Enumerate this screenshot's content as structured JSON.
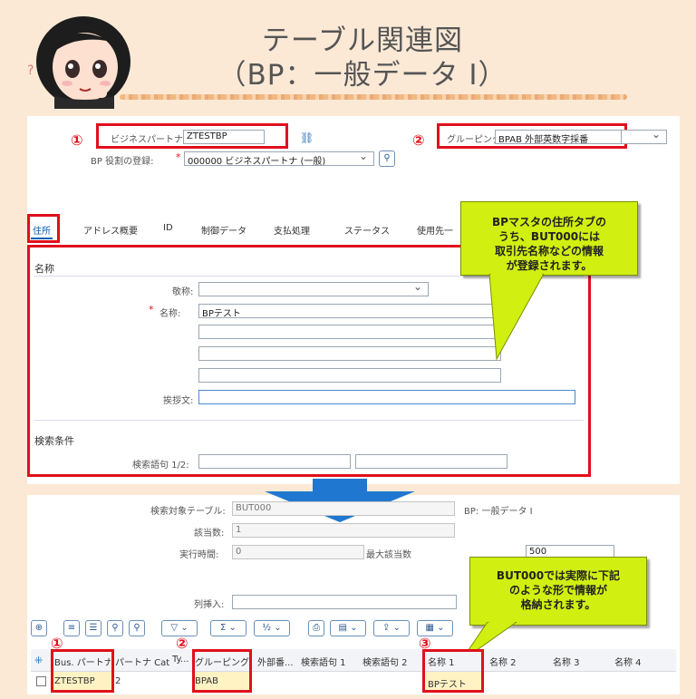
{
  "title": {
    "line1": "テーブル関連図",
    "line2": "（BP：一般データ Ⅰ）"
  },
  "header_form": {
    "bp_label": "ビジネスパートナ",
    "bp_value": "ZTESTBP",
    "role_label": "BP 役割の登録:",
    "role_value": "000000 ビジネスパートナ (一般)",
    "grouping_label": "グルーピング",
    "grouping_value": "BPAB 外部英数字採番"
  },
  "markers": {
    "one": "①",
    "two": "②",
    "three": "③"
  },
  "tabs": [
    "住所",
    "アドレス概要",
    "ID",
    "制御データ",
    "支払処理",
    "ステータス",
    "使用先一"
  ],
  "name_section": {
    "heading": "名称",
    "salutation_label": "敬称:",
    "name_label": "名称:",
    "name_value": "BPテスト",
    "greeting_label": "挨拶文:"
  },
  "search_section": {
    "heading": "検索条件",
    "terms_label": "検索語句 1/2:"
  },
  "callout1": [
    "BPマスタの住所タブの",
    "うち、BUT000には",
    "取引先名称などの情報",
    "が登録されます。"
  ],
  "callout2": [
    "BUT000では実際に下記",
    "のような形で情報が",
    "格納されます。"
  ],
  "se16": {
    "table_label": "検索対象テーブル:",
    "table_value": "BUT000",
    "table_desc": "BP: 一般データ I",
    "hits_label": "該当数:",
    "hits_value": "1",
    "runtime_label": "実行時間:",
    "runtime_value": "0",
    "maxhits_label": "最大該当数",
    "maxhits_value": "500",
    "colins_label": "列挿入:"
  },
  "table": {
    "headers": [
      "Bus. パートナ",
      "パートナ Cat.",
      "Ty...",
      "グルーピング",
      "外部番...",
      "検索語句 1",
      "検索語句 2",
      "名称 1",
      "名称 2",
      "名称 3",
      "名称 4"
    ],
    "row": [
      "ZTESTBP",
      "2",
      "",
      "BPAB",
      "",
      "",
      "",
      "BPテスト",
      "",
      "",
      ""
    ]
  },
  "colors": {
    "red": "#e0101c",
    "callout": "#d1ef11",
    "arrow": "#1f77d0",
    "bg": "#fbe9d6"
  }
}
